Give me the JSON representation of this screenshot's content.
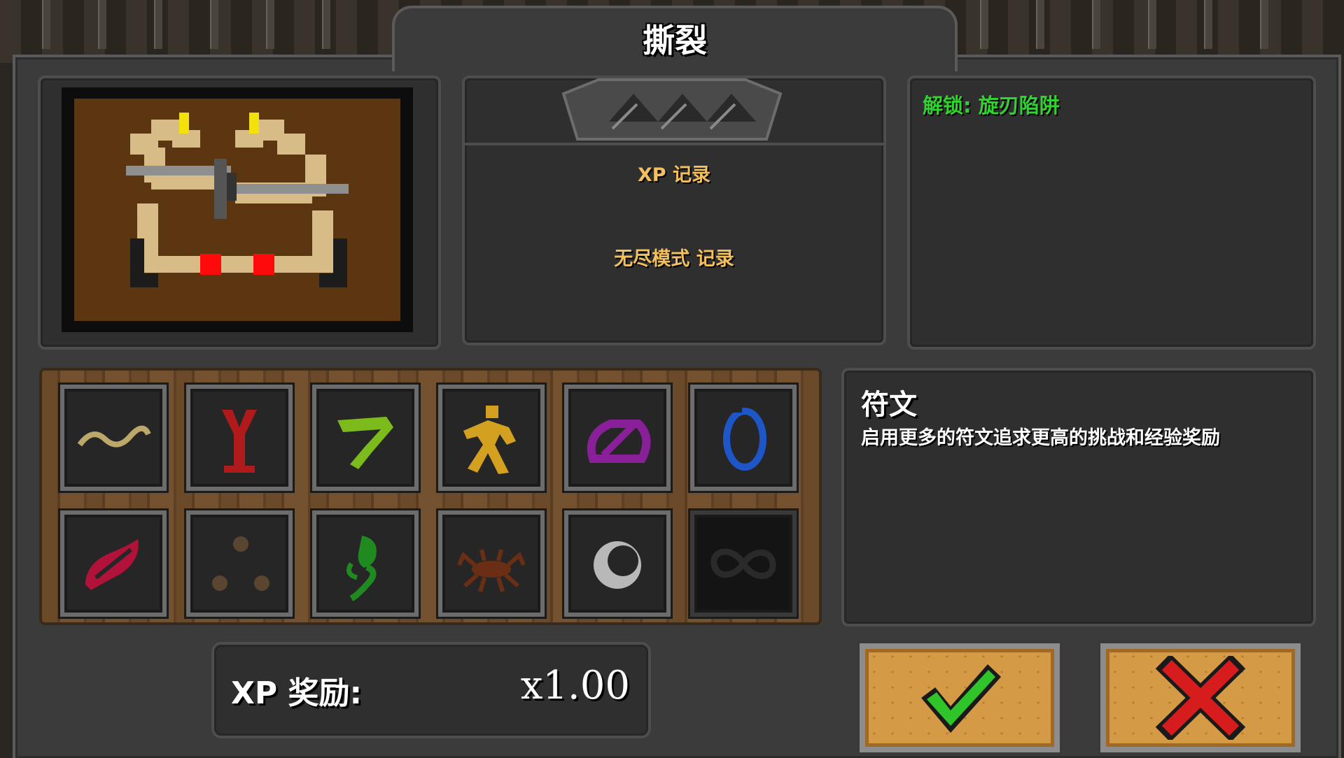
{
  "title": "撕裂",
  "stats": {
    "xp_record_label": "XP 记录",
    "endless_record_label": "无尽模式 记录"
  },
  "unlock_text": "解锁: 旋刃陷阱",
  "description": {
    "title": "符文",
    "text": "启用更多的符文追求更高的挑战和经验奖励"
  },
  "xp_bonus": {
    "label": "XP 奖励:",
    "value": "x1.00"
  },
  "runes": [
    {
      "icon": "wave-rune-icon",
      "color": "#bca86a",
      "locked": false
    },
    {
      "icon": "spike-rune-icon",
      "color": "#b01a1a",
      "locked": false
    },
    {
      "icon": "hook-rune-icon",
      "color": "#7dba1c",
      "locked": false
    },
    {
      "icon": "runner-rune-icon",
      "color": "#d4a020",
      "locked": false
    },
    {
      "icon": "slashed-circle-rune-icon",
      "color": "#8a1f9a",
      "locked": false
    },
    {
      "icon": "ring-rune-icon",
      "color": "#1e56c8",
      "locked": false
    },
    {
      "icon": "slash-rune-icon",
      "color": "#b0123a",
      "locked": false
    },
    {
      "icon": "dots-rune-icon",
      "color": "#5a4630",
      "locked": false
    },
    {
      "icon": "sprout-rune-icon",
      "color": "#1f8a1f",
      "locked": false
    },
    {
      "icon": "crab-rune-icon",
      "color": "#6a2e14",
      "locked": false
    },
    {
      "icon": "crescent-rune-icon",
      "color": "#b8b8b8",
      "locked": false
    },
    {
      "icon": "infinity-rune-icon",
      "color": "#2a2a2a",
      "locked": true
    }
  ],
  "colors": {
    "confirm": "#2fc42a",
    "cancel": "#d61c1c",
    "button_face": "#d59a45"
  }
}
